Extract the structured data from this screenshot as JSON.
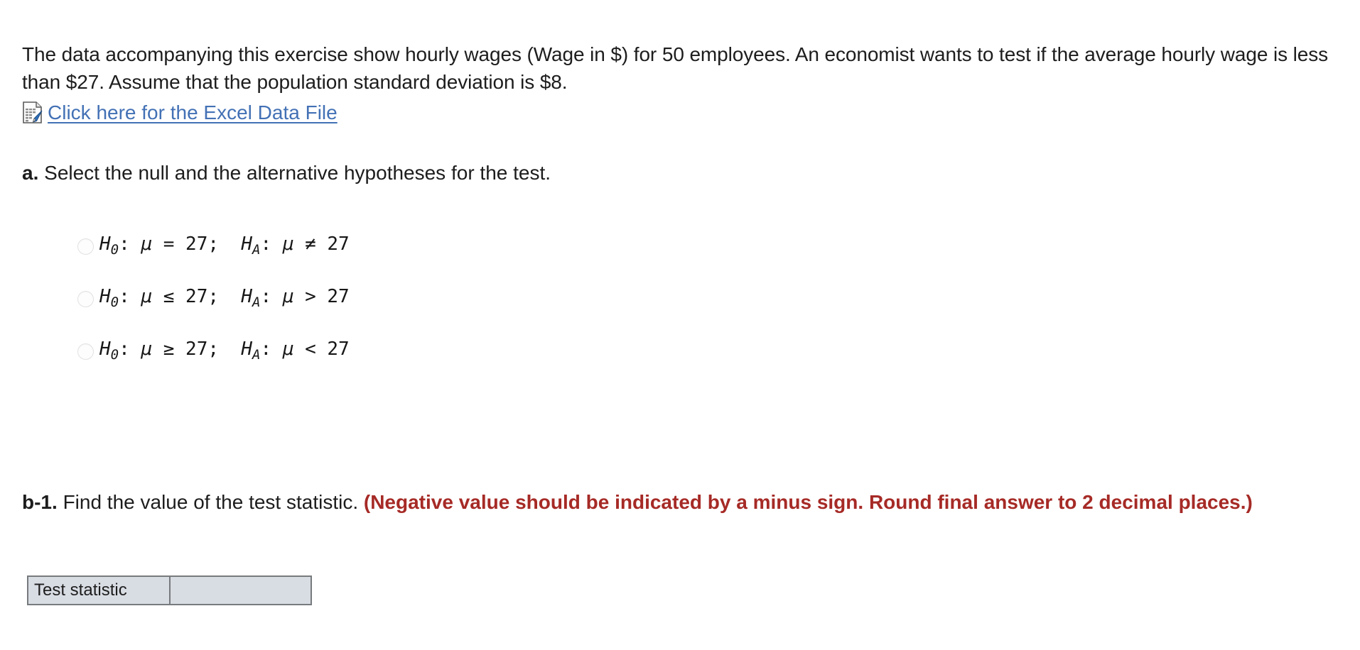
{
  "intro": {
    "text": "The data accompanying this exercise show hourly wages (Wage in $) for 50 employees. An economist wants to test if the average hourly wage is less than $27. Assume that the population standard deviation is $8."
  },
  "file_link": {
    "icon": "excel-document-icon",
    "label": "Click here for the Excel Data File",
    "color": "#4371b5"
  },
  "part_a": {
    "marker": "a.",
    "prompt": "Select the null and the alternative hypotheses for the test.",
    "options": [
      {
        "id": "option-1",
        "selected": false,
        "null_symbol": "H",
        "null_sub": "0",
        "null_rel": "=",
        "null_value": "27",
        "alt_symbol": "H",
        "alt_sub": "A",
        "alt_rel": "≠",
        "alt_value": "27",
        "text": "H0: μ = 27; HA: μ ≠ 27"
      },
      {
        "id": "option-2",
        "selected": false,
        "null_symbol": "H",
        "null_sub": "0",
        "null_rel": "≤",
        "null_value": "27",
        "alt_symbol": "H",
        "alt_sub": "A",
        "alt_rel": ">",
        "alt_value": "27",
        "text": "H0: μ ≤ 27; HA: μ > 27"
      },
      {
        "id": "option-3",
        "selected": false,
        "null_symbol": "H",
        "null_sub": "0",
        "null_rel": "≥",
        "null_value": "27",
        "alt_symbol": "H",
        "alt_sub": "A",
        "alt_rel": "<",
        "alt_value": "27",
        "text": "H0: μ ≥ 27; HA: μ < 27"
      }
    ],
    "mu": "μ",
    "colon": ":",
    "semicolon": ";"
  },
  "part_b1": {
    "marker": "b-1.",
    "prompt": "Find the value of the test statistic.",
    "instruction": "(Negative value should be indicated by a minus sign. Round final answer to 2 decimal places.)",
    "instruction_color": "#a62a26"
  },
  "answer_table": {
    "row_label": "Test statistic",
    "value": "",
    "value_placeholder": "",
    "fill_color": "#d8dce3",
    "border_color": "#777b7e"
  }
}
